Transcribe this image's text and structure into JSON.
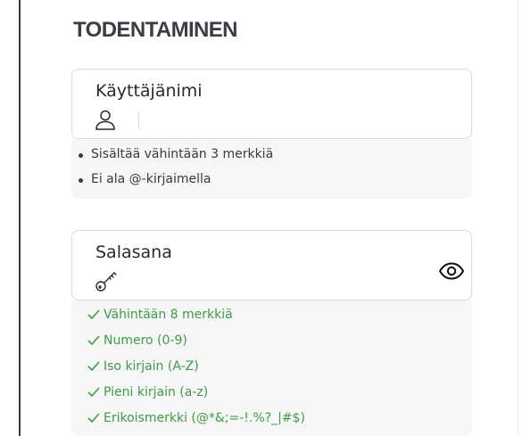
{
  "section": {
    "title": "TODENTAMINEN"
  },
  "username": {
    "label": "Käyttäjänimi",
    "icon": "user-icon",
    "value": "",
    "requirements": [
      "Sisältää vähintään 3 merkkiä",
      "Ei ala @-kirjaimella"
    ]
  },
  "password": {
    "label": "Salasana",
    "icon": "key-icon",
    "toggle_icon": "eye-icon",
    "value": "",
    "requirements": [
      "Vähintään 8 merkkiä",
      "Numero (0-9)",
      "Iso kirjain (A-Z)",
      "Pieni kirjain (a-z)",
      "Erikoismerkki (@*&;=-!.%?_|#$)"
    ]
  },
  "colors": {
    "requirement_met": "#3f9a47",
    "heading": "#3c3c46"
  }
}
